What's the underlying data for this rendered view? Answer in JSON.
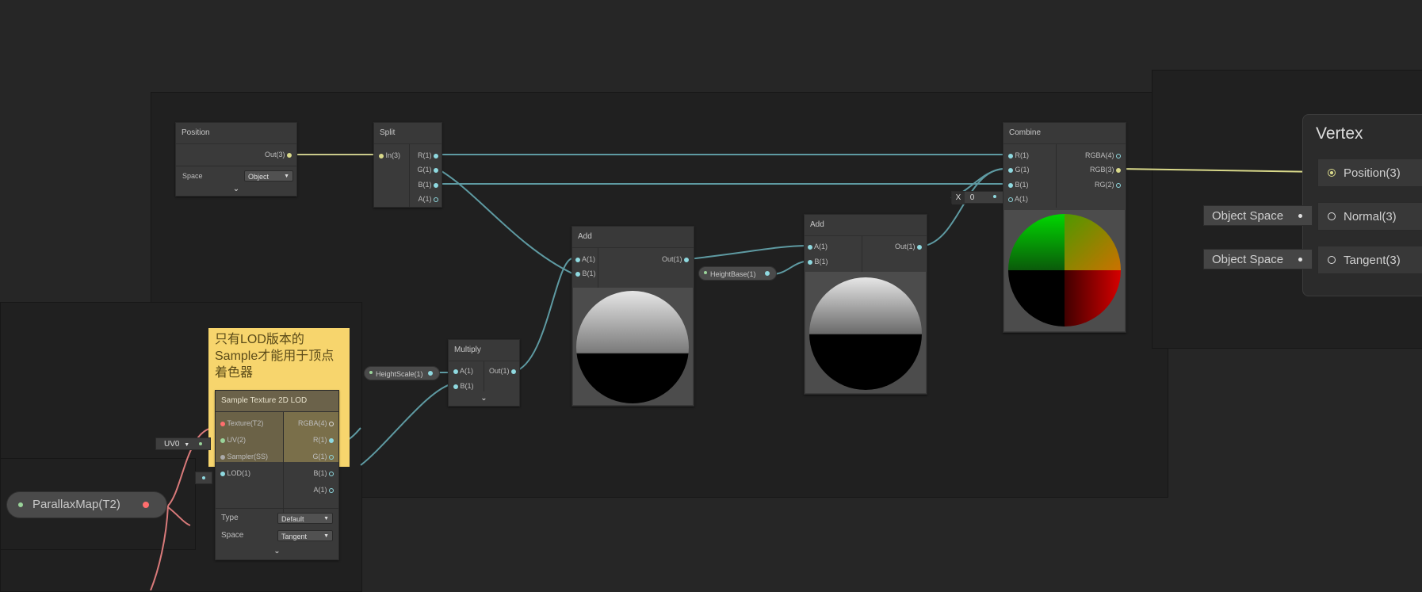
{
  "colors": {
    "vector3_wire": "#d9d98a",
    "float_wire": "#5e9aa2",
    "texture_wire": "#d97a7a",
    "sticky": "#f7d56d"
  },
  "position_node": {
    "title": "Position",
    "out": "Out(3)",
    "space_label": "Space",
    "space_value": "Object"
  },
  "split_node": {
    "title": "Split",
    "in": "In(3)",
    "outs": [
      "R(1)",
      "G(1)",
      "B(1)",
      "A(1)"
    ]
  },
  "add_node_1": {
    "title": "Add",
    "in_a": "A(1)",
    "in_b": "B(1)",
    "out": "Out(1)"
  },
  "add_node_2": {
    "title": "Add",
    "in_a": "A(1)",
    "in_b": "B(1)",
    "out": "Out(1)"
  },
  "multiply_node": {
    "title": "Multiply",
    "in_a": "A(1)",
    "in_b": "B(1)",
    "out": "Out(1)"
  },
  "combine_node": {
    "title": "Combine",
    "ins": [
      "R(1)",
      "G(1)",
      "B(1)",
      "A(1)"
    ],
    "outs": [
      "RGBA(4)",
      "RGB(3)",
      "RG(2)"
    ],
    "inline_a_label": "X",
    "inline_a_value": "0"
  },
  "height_base_property": {
    "label": "HeightBase(1)"
  },
  "height_scale_property": {
    "label": "HeightScale(1)"
  },
  "parallax_map_property": {
    "label": "ParallaxMap(T2)"
  },
  "sticky_note": {
    "text": "只有LOD版本的Sample才能用于顶点着色器"
  },
  "sample_node": {
    "title": "Sample Texture 2D LOD",
    "ins": [
      "Texture(T2)",
      "UV(2)",
      "Sampler(SS)",
      "LOD(1)"
    ],
    "outs": [
      "RGBA(4)",
      "R(1)",
      "G(1)",
      "B(1)",
      "A(1)"
    ],
    "type_label": "Type",
    "type_value": "Default",
    "space_label": "Space",
    "space_value": "Tangent",
    "uv_inline": "UV0"
  },
  "vertex_block": {
    "title": "Vertex",
    "slots": [
      "Position(3)",
      "Normal(3)",
      "Tangent(3)"
    ],
    "normal_space": "Object Space",
    "tangent_space": "Object Space"
  }
}
